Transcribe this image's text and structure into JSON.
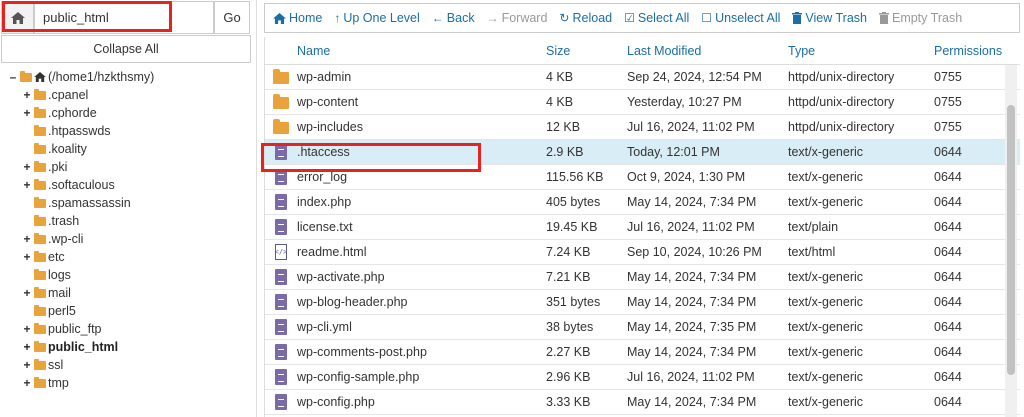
{
  "pathbar": {
    "path_value": "public_html",
    "go_label": "Go"
  },
  "collapse_label": "Collapse All",
  "tree": [
    {
      "toggle": "–",
      "label": "(/home1/hzkthsmy)",
      "indent": 8,
      "home": true
    },
    {
      "toggle": "+",
      "label": ".cpanel",
      "indent": 22
    },
    {
      "toggle": "+",
      "label": ".cphorde",
      "indent": 22
    },
    {
      "toggle": "",
      "label": ".htpasswds",
      "indent": 22
    },
    {
      "toggle": "",
      "label": ".koality",
      "indent": 22
    },
    {
      "toggle": "+",
      "label": ".pki",
      "indent": 22
    },
    {
      "toggle": "+",
      "label": ".softaculous",
      "indent": 22
    },
    {
      "toggle": "",
      "label": ".spamassassin",
      "indent": 22
    },
    {
      "toggle": "",
      "label": ".trash",
      "indent": 22
    },
    {
      "toggle": "+",
      "label": ".wp-cli",
      "indent": 22
    },
    {
      "toggle": "+",
      "label": "etc",
      "indent": 22
    },
    {
      "toggle": "",
      "label": "logs",
      "indent": 22
    },
    {
      "toggle": "+",
      "label": "mail",
      "indent": 22
    },
    {
      "toggle": "",
      "label": "perl5",
      "indent": 22
    },
    {
      "toggle": "+",
      "label": "public_ftp",
      "indent": 22
    },
    {
      "toggle": "+",
      "label": "public_html",
      "indent": 22,
      "bold": true
    },
    {
      "toggle": "+",
      "label": "ssl",
      "indent": 22
    },
    {
      "toggle": "+",
      "label": "tmp",
      "indent": 22
    }
  ],
  "toolbar": {
    "home": "Home",
    "up": "Up One Level",
    "back": "Back",
    "forward": "Forward",
    "reload": "Reload",
    "select_all": "Select All",
    "unselect_all": "Unselect All",
    "view_trash": "View Trash",
    "empty_trash": "Empty Trash"
  },
  "columns": {
    "name": "Name",
    "size": "Size",
    "modified": "Last Modified",
    "type": "Type",
    "perms": "Permissions"
  },
  "files": [
    {
      "icon": "folder",
      "name": "wp-admin",
      "size": "4 KB",
      "modified": "Sep 24, 2024, 12:54 PM",
      "type": "httpd/unix-directory",
      "perms": "0755"
    },
    {
      "icon": "folder",
      "name": "wp-content",
      "size": "4 KB",
      "modified": "Yesterday, 10:27 PM",
      "type": "httpd/unix-directory",
      "perms": "0755"
    },
    {
      "icon": "folder",
      "name": "wp-includes",
      "size": "12 KB",
      "modified": "Jul 16, 2024, 11:02 PM",
      "type": "httpd/unix-directory",
      "perms": "0755"
    },
    {
      "icon": "file",
      "name": ".htaccess",
      "size": "2.9 KB",
      "modified": "Today, 12:01 PM",
      "type": "text/x-generic",
      "perms": "0644",
      "selected": true
    },
    {
      "icon": "file",
      "name": "error_log",
      "size": "115.56 KB",
      "modified": "Oct 9, 2024, 1:30 PM",
      "type": "text/x-generic",
      "perms": "0644"
    },
    {
      "icon": "file",
      "name": "index.php",
      "size": "405 bytes",
      "modified": "May 14, 2024, 7:34 PM",
      "type": "text/x-generic",
      "perms": "0644"
    },
    {
      "icon": "file",
      "name": "license.txt",
      "size": "19.45 KB",
      "modified": "Jul 16, 2024, 11:02 PM",
      "type": "text/plain",
      "perms": "0644"
    },
    {
      "icon": "html",
      "name": "readme.html",
      "size": "7.24 KB",
      "modified": "Sep 10, 2024, 10:26 PM",
      "type": "text/html",
      "perms": "0644"
    },
    {
      "icon": "file",
      "name": "wp-activate.php",
      "size": "7.21 KB",
      "modified": "May 14, 2024, 7:34 PM",
      "type": "text/x-generic",
      "perms": "0644"
    },
    {
      "icon": "file",
      "name": "wp-blog-header.php",
      "size": "351 bytes",
      "modified": "May 14, 2024, 7:34 PM",
      "type": "text/x-generic",
      "perms": "0644"
    },
    {
      "icon": "file",
      "name": "wp-cli.yml",
      "size": "38 bytes",
      "modified": "May 14, 2024, 7:35 PM",
      "type": "text/x-generic",
      "perms": "0644"
    },
    {
      "icon": "file",
      "name": "wp-comments-post.php",
      "size": "2.27 KB",
      "modified": "May 14, 2024, 7:34 PM",
      "type": "text/x-generic",
      "perms": "0644"
    },
    {
      "icon": "file",
      "name": "wp-config-sample.php",
      "size": "2.96 KB",
      "modified": "Jul 16, 2024, 11:02 PM",
      "type": "text/x-generic",
      "perms": "0644"
    },
    {
      "icon": "file",
      "name": "wp-config.php",
      "size": "3.33 KB",
      "modified": "May 14, 2024, 7:34 PM",
      "type": "text/x-generic",
      "perms": "0644"
    }
  ]
}
